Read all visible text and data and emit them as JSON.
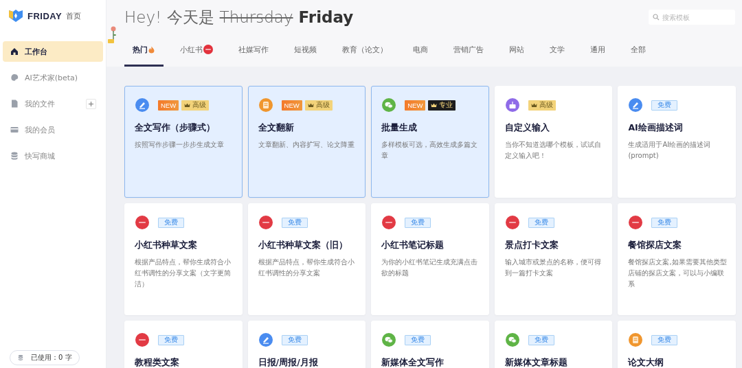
{
  "brand": {
    "name": "FRIDAY",
    "home": "首页"
  },
  "sidebar": {
    "items": [
      {
        "label": "工作台",
        "kind": "home",
        "selected": true
      },
      {
        "label": "AI艺术家(beta)",
        "kind": "palette",
        "selected": false
      },
      {
        "label": "我的文件",
        "kind": "file",
        "selected": false
      },
      {
        "label": "我的会员",
        "kind": "card",
        "selected": false
      },
      {
        "label": "快写商城",
        "kind": "db",
        "selected": false
      }
    ],
    "usage": "已使用：0 字"
  },
  "greeting": {
    "prefix": "Hey! 今天是",
    "struck": "Thursday",
    "current": "Friday"
  },
  "search": {
    "placeholder": "搜索模板"
  },
  "tabs": [
    {
      "label": "热门",
      "kind": "hot",
      "selected": true
    },
    {
      "label": "小红书",
      "kind": "badged",
      "selected": false
    },
    {
      "label": "社媒写作",
      "kind": "plain",
      "selected": false
    },
    {
      "label": "短视频",
      "kind": "plain",
      "selected": false
    },
    {
      "label": "教育（论文）",
      "kind": "plain",
      "selected": false
    },
    {
      "label": "电商",
      "kind": "plain",
      "selected": false
    },
    {
      "label": "营销广告",
      "kind": "plain",
      "selected": false
    },
    {
      "label": "网站",
      "kind": "plain",
      "selected": false
    },
    {
      "label": "文学",
      "kind": "plain",
      "selected": false
    },
    {
      "label": "通用",
      "kind": "plain",
      "selected": false
    },
    {
      "label": "全部",
      "kind": "plain",
      "selected": false
    }
  ],
  "cards": [
    {
      "kind": "pen",
      "badges": [
        {
          "kind": "new",
          "text": "NEW"
        },
        {
          "kind": "advanced",
          "text": "高级"
        }
      ],
      "title": "全文写作（步骤式）",
      "desc": "按照写作步骤一步步生成文章",
      "selected": true
    },
    {
      "kind": "doc",
      "badges": [
        {
          "kind": "new",
          "text": "NEW"
        },
        {
          "kind": "advanced",
          "text": "高级"
        }
      ],
      "title": "全文翻新",
      "desc": "文章翻新、内容扩写、论文降重",
      "selected": true
    },
    {
      "kind": "chat",
      "badges": [
        {
          "kind": "new",
          "text": "NEW"
        },
        {
          "kind": "pro",
          "text": "专业"
        }
      ],
      "title": "批量生成",
      "desc": "多样模板可选，高效生成多篇文章",
      "selected": true
    },
    {
      "kind": "cake",
      "badges": [
        {
          "kind": "advanced",
          "text": "高级"
        }
      ],
      "title": "自定义输入",
      "desc": "当你不知道选哪个模板，试试自定义输入吧！",
      "selected": false
    },
    {
      "kind": "pen",
      "badges": [
        {
          "kind": "free",
          "text": "免费"
        }
      ],
      "title": "AI绘画描述词",
      "desc": "生成适用于AI绘画的描述词(prompt)",
      "selected": false
    },
    {
      "kind": "red",
      "badges": [
        {
          "kind": "free",
          "text": "免费"
        }
      ],
      "title": "小红书种草文案",
      "desc": "根据产品特点，帮你生成符合小红书调性的分享文案（文字更简洁）",
      "selected": false
    },
    {
      "kind": "red",
      "badges": [
        {
          "kind": "free",
          "text": "免费"
        }
      ],
      "title": "小红书种草文案（旧）",
      "desc": "根据产品特点，帮你生成符合小红书调性的分享文案",
      "selected": false
    },
    {
      "kind": "red",
      "badges": [
        {
          "kind": "free",
          "text": "免费"
        }
      ],
      "title": "小红书笔记标题",
      "desc": "为你的小红书笔记生成充满点击欲的标题",
      "selected": false
    },
    {
      "kind": "red",
      "badges": [
        {
          "kind": "free",
          "text": "免费"
        }
      ],
      "title": "景点打卡文案",
      "desc": "输入城市或景点的名称，便可得到一篇打卡文案",
      "selected": false
    },
    {
      "kind": "red",
      "badges": [
        {
          "kind": "free",
          "text": "免费"
        }
      ],
      "title": "餐馆探店文案",
      "desc": "餐馆探店文案,如果需要其他类型店铺的探店文案，可以与小编联系",
      "selected": false
    },
    {
      "kind": "red",
      "badges": [
        {
          "kind": "free",
          "text": "免费"
        }
      ],
      "title": "教程类文案",
      "selected": false
    },
    {
      "kind": "pen",
      "badges": [
        {
          "kind": "free",
          "text": "免费"
        }
      ],
      "title": "日报/周报/月报",
      "selected": false
    },
    {
      "kind": "chat",
      "badges": [
        {
          "kind": "free",
          "text": "免费"
        }
      ],
      "title": "新媒体全文写作",
      "selected": false
    },
    {
      "kind": "chat",
      "badges": [
        {
          "kind": "free",
          "text": "免费"
        }
      ],
      "title": "新媒体文章标题",
      "selected": false
    },
    {
      "kind": "doc",
      "badges": [
        {
          "kind": "free",
          "text": "免费"
        }
      ],
      "title": "论文大纲",
      "selected": false
    }
  ]
}
